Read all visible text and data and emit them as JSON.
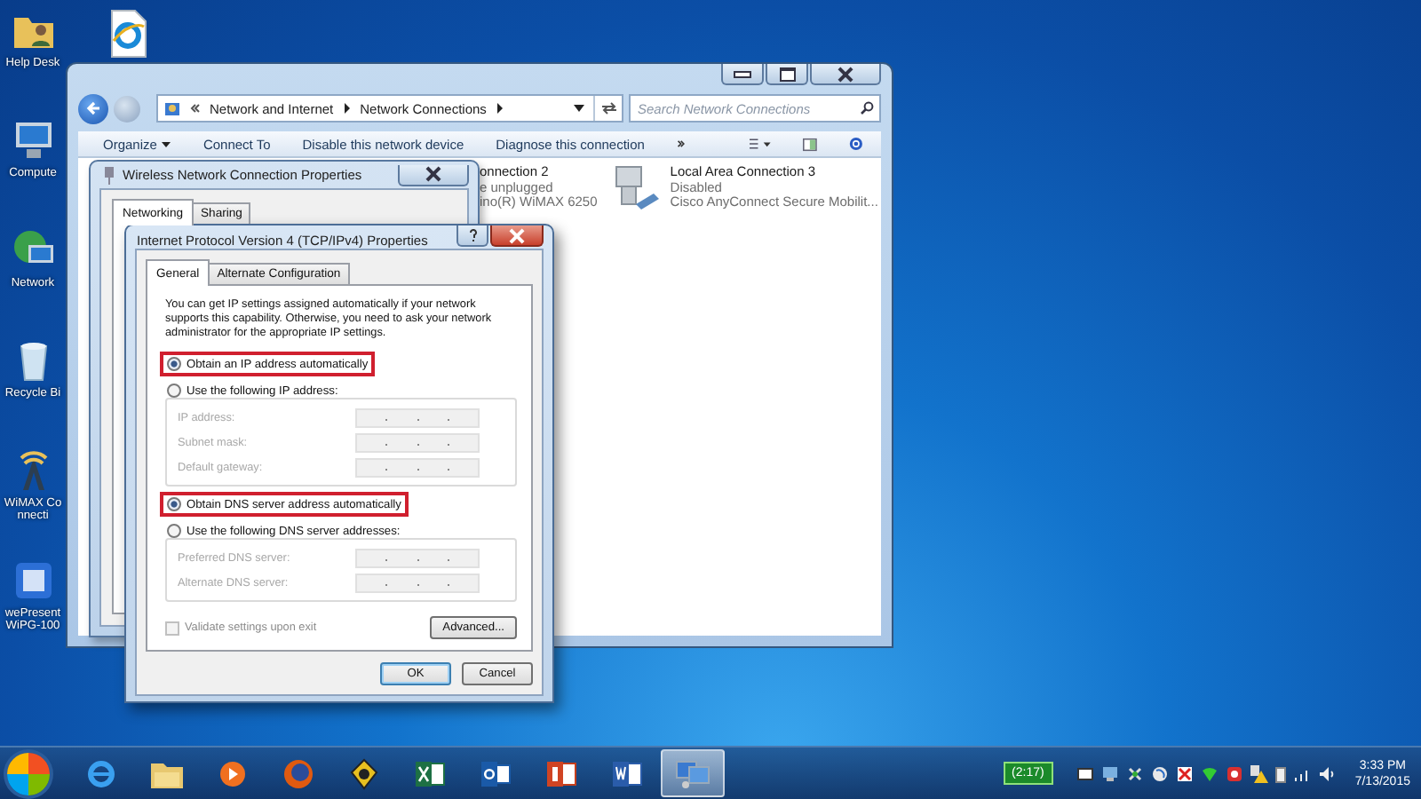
{
  "desktop": {
    "columns": [
      {
        "icons": [
          {
            "kind": "user-folder",
            "label": "Help Desk"
          },
          {
            "kind": "computer",
            "label": "Compute"
          },
          {
            "kind": "network",
            "label": "Network"
          },
          {
            "kind": "recycle-bin",
            "label": "Recycle Bi"
          },
          {
            "kind": "antenna",
            "label": "WiMAX Connecti"
          },
          {
            "kind": "presenter",
            "label": "wePresent WiPG-100"
          }
        ]
      },
      {
        "icons": [
          {
            "kind": "web-page"
          }
        ]
      }
    ]
  },
  "explorer": {
    "breadcrumb": [
      "Network and Internet",
      "Network Connections"
    ],
    "search": {
      "placeholder": "Search Network Connections"
    },
    "toolbar": [
      {
        "label": "Organize",
        "dropdown": true
      },
      {
        "label": "Connect To",
        "dropdown": false
      },
      {
        "label": "Disable this network device",
        "dropdown": false
      },
      {
        "label": "Diagnose this connection",
        "dropdown": false
      }
    ],
    "connections": [
      {
        "kind": "text-only",
        "name": "onnection 2",
        "lines": [
          "e unplugged",
          "ino(R) WiMAX 6250"
        ]
      },
      {
        "kind": "computer-adapter",
        "name": "Local Area Connection 3",
        "lines": [
          "Disabled",
          "Cisco AnyConnect Secure Mobilit..."
        ]
      }
    ]
  },
  "wireless": {
    "title": "Wireless Network Connection Properties",
    "tabs": [
      {
        "label": "Networking",
        "selected": true
      },
      {
        "label": "Sharing",
        "selected": false
      }
    ]
  },
  "ipv4": {
    "title": "Internet Protocol Version 4 (TCP/IPv4) Properties",
    "tabs": [
      {
        "label": "General",
        "selected": true
      },
      {
        "label": "Alternate Configuration",
        "selected": false
      }
    ],
    "intro": "You can get IP settings assigned automatically if your network supports this capability. Otherwise, you need to ask your network administrator for the appropriate IP settings.",
    "ip_options": [
      {
        "label": "Obtain an IP address automatically",
        "selected": true,
        "highlighted": true
      },
      {
        "label": "Use the following IP address:",
        "selected": false,
        "highlighted": false
      }
    ],
    "ip_fields": {
      "disabled": true,
      "rows": [
        {
          "label": "IP address:"
        },
        {
          "label": "Subnet mask:"
        },
        {
          "label": "Default gateway:"
        }
      ]
    },
    "dns_options": [
      {
        "label": "Obtain DNS server address automatically",
        "selected": true,
        "highlighted": true
      },
      {
        "label": "Use the following DNS server addresses:",
        "selected": false,
        "highlighted": false
      }
    ],
    "dns_fields": {
      "disabled": true,
      "rows": [
        {
          "label": "Preferred DNS server:"
        },
        {
          "label": "Alternate DNS server:"
        }
      ]
    },
    "validate": {
      "label": "Validate settings upon exit",
      "checked": false,
      "disabled": true
    },
    "advanced_button": "Advanced...",
    "buttons": [
      {
        "label": "OK",
        "default": true
      },
      {
        "label": "Cancel",
        "default": false
      }
    ]
  },
  "taskbar": {
    "apps": [
      {
        "kind": "browser",
        "selected": false
      },
      {
        "kind": "folder",
        "selected": false
      },
      {
        "kind": "player",
        "selected": false
      },
      {
        "kind": "fox",
        "selected": false
      },
      {
        "kind": "badge",
        "selected": false
      },
      {
        "kind": "sheet",
        "selected": false
      },
      {
        "kind": "mail",
        "selected": false
      },
      {
        "kind": "slides",
        "selected": false
      },
      {
        "kind": "doc",
        "selected": false
      },
      {
        "kind": "network",
        "selected": true
      }
    ],
    "battery": "(2:17)",
    "time": "3:33 PM",
    "date": "7/13/2015"
  }
}
